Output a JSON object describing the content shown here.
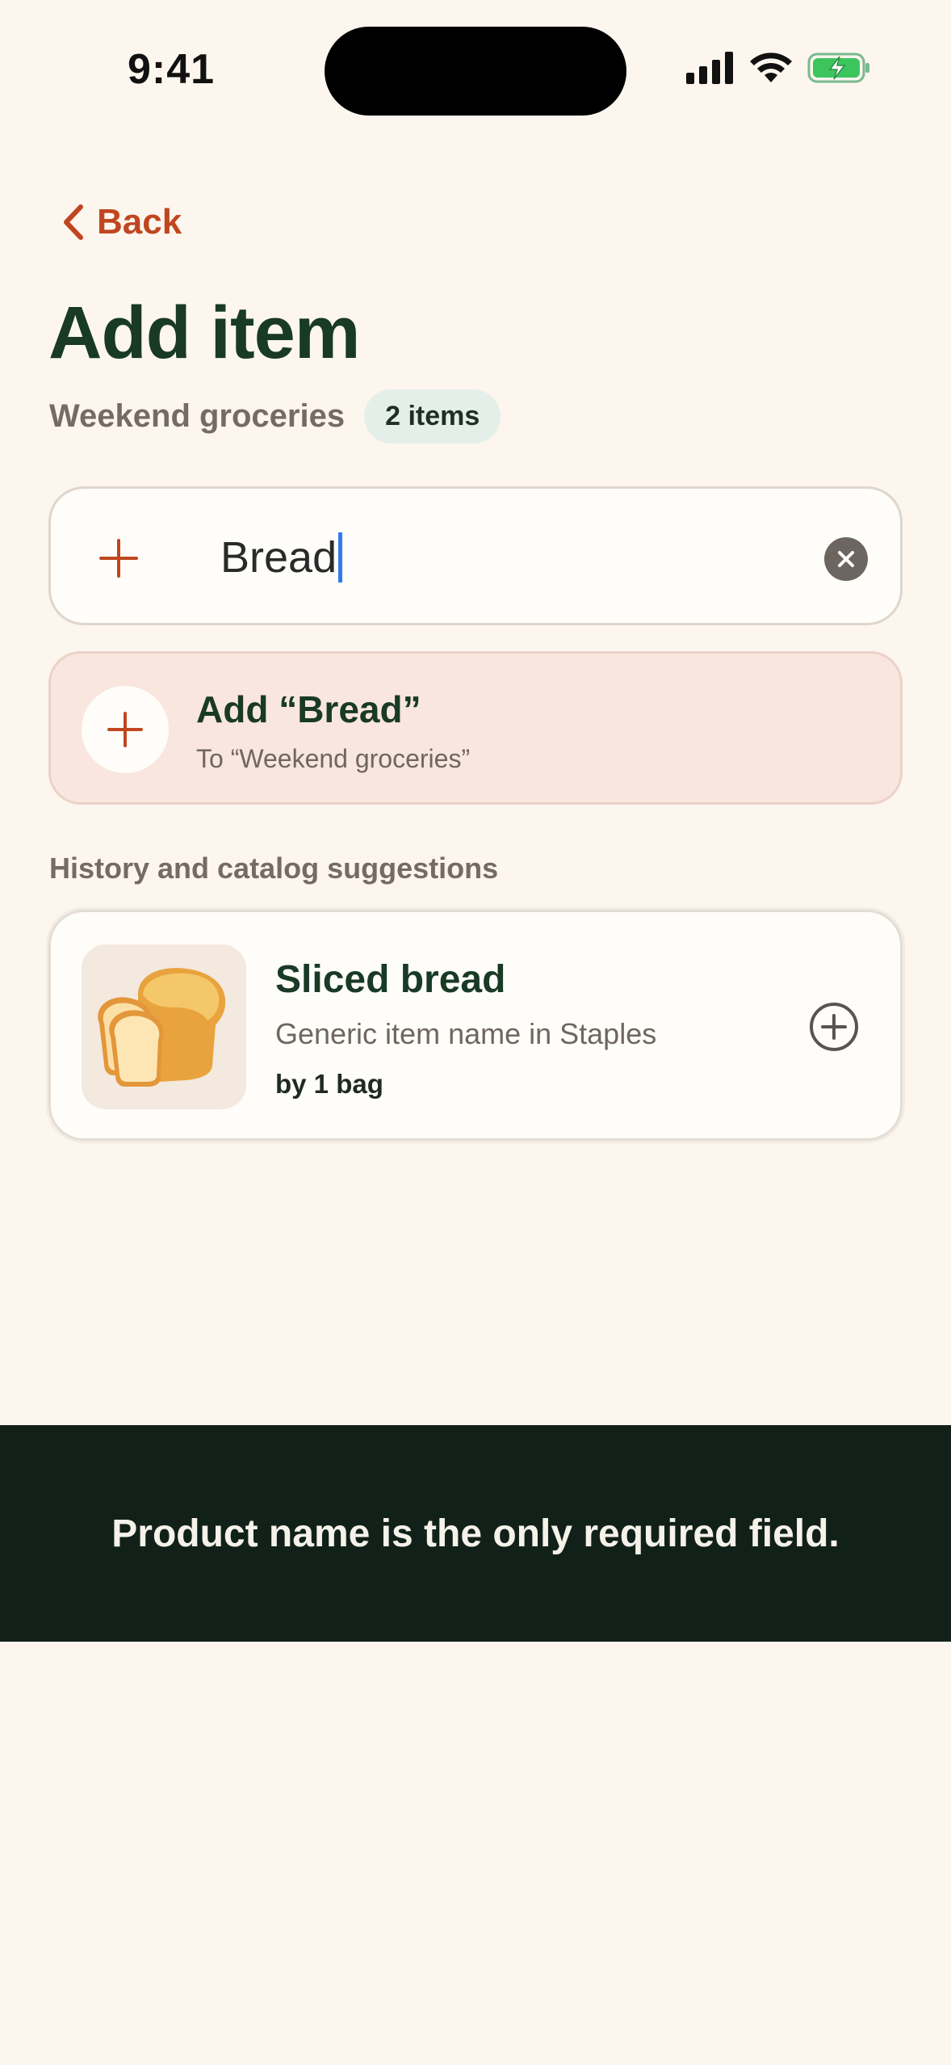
{
  "status_bar": {
    "time": "9:41"
  },
  "nav": {
    "back_label": "Back"
  },
  "header": {
    "title": "Add item",
    "list_name": "Weekend groceries",
    "count_badge": "2 items"
  },
  "search": {
    "value": "Bread"
  },
  "add_suggestion": {
    "title": "Add “Bread”",
    "subtitle": "To “Weekend groceries”"
  },
  "suggestions": {
    "section_label": "History and catalog suggestions",
    "items": [
      {
        "name": "Sliced bread",
        "description": "Generic item name in Staples",
        "quantity": "by 1 bag"
      }
    ]
  },
  "toast": {
    "message": "Product name is the only required field."
  },
  "colors": {
    "accent": "#c0461f",
    "title": "#193a25",
    "background": "#fcf6ee",
    "toast_bg": "#112119"
  }
}
